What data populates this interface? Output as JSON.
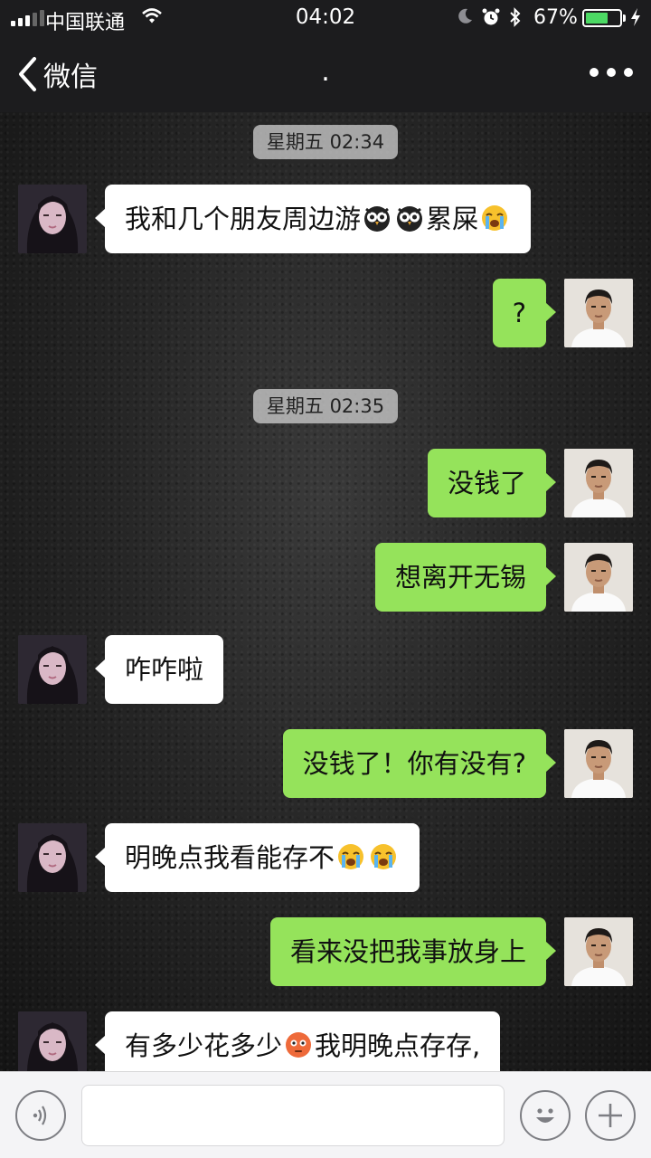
{
  "status_bar": {
    "carrier": "中国联通",
    "time": "04:02",
    "battery_percent": "67%",
    "battery_level": 0.67
  },
  "nav": {
    "back_label": "微信",
    "title": ".",
    "more_icon": "more-dots-icon"
  },
  "messages": [
    {
      "type": "timestamp",
      "text": "星期五 02:34"
    },
    {
      "type": "message",
      "side": "left",
      "text": "我和几个朋友周边游",
      "emojis_after": [
        "owl-emoji",
        "owl-emoji"
      ],
      "text2": "累屎",
      "emojis_end": [
        "crying-emoji"
      ]
    },
    {
      "type": "message",
      "side": "right",
      "text": "?"
    },
    {
      "type": "timestamp",
      "text": "星期五 02:35"
    },
    {
      "type": "message",
      "side": "right",
      "text": "没钱了"
    },
    {
      "type": "message",
      "side": "right",
      "text": "想离开无锡"
    },
    {
      "type": "message",
      "side": "left",
      "text": "咋咋啦"
    },
    {
      "type": "message",
      "side": "right",
      "text": "没钱了！你有没有?"
    },
    {
      "type": "message",
      "side": "left",
      "text": "明晚点我看能存不",
      "emojis_end": [
        "crying-emoji",
        "crying-emoji"
      ]
    },
    {
      "type": "message",
      "side": "right",
      "text": "看来没把我事放身上"
    },
    {
      "type": "message",
      "side": "left",
      "text": "有多少花多少",
      "emojis_after": [
        "flushed-emoji"
      ],
      "text2": "我明晚点存存,"
    }
  ],
  "input_bar": {
    "voice_icon": "voice-icon",
    "input_value": "",
    "emoji_icon": "smiley-icon",
    "plus_icon": "plus-icon"
  },
  "colors": {
    "sent_bubble": "#95e35b",
    "received_bubble": "#ffffff",
    "nav_background": "#1c1c1e",
    "battery_fill": "#4cd964"
  }
}
